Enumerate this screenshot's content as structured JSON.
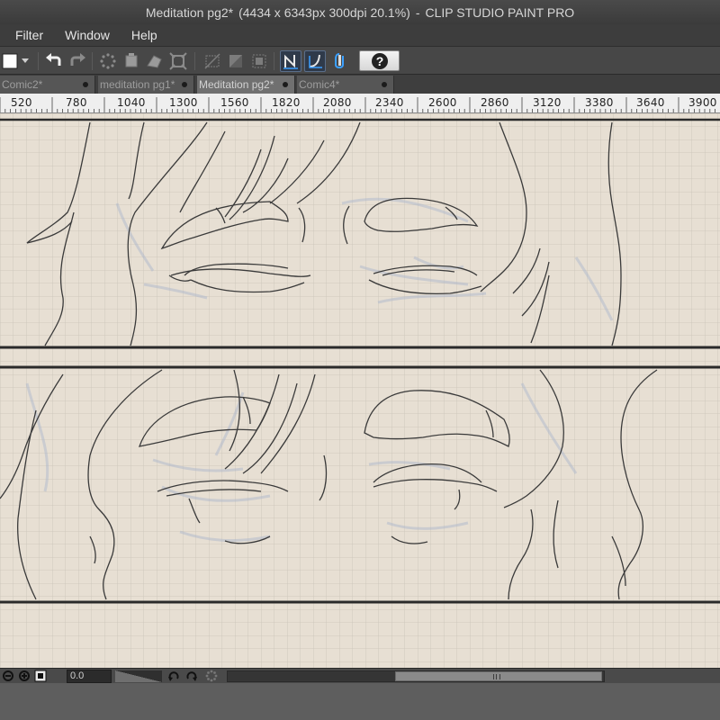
{
  "window": {
    "title_main": "Meditation pg2*",
    "title_info": "(4434 x 6343px 300dpi 20.1%)",
    "title_sep": "-",
    "app_name": "CLIP STUDIO PAINT PRO"
  },
  "menu": {
    "items": [
      "Filter",
      "Window",
      "Help"
    ]
  },
  "toolbar": {
    "icons": [
      "color-swatch-icon",
      "dropdown-arrow-icon",
      "undo-icon",
      "redo-icon",
      "clear-icon",
      "fill-icon",
      "transform-icon",
      "scale-icon",
      "deselect-icon",
      "invert-selection-icon",
      "selection-border-icon",
      "snap-to-ruler-icon",
      "snap-to-special-ruler-icon",
      "snap-to-grid-icon",
      "help-icon"
    ]
  },
  "tabs": [
    {
      "label": "Comic2*",
      "active": false
    },
    {
      "label": "meditation pg1*",
      "active": false
    },
    {
      "label": "Meditation pg2*",
      "active": true
    },
    {
      "label": "Comic4*",
      "active": false
    }
  ],
  "ruler": {
    "labels": [
      "520",
      "780",
      "1040",
      "1300",
      "1560",
      "1820",
      "2080",
      "2340",
      "2600",
      "2860",
      "3120",
      "3380",
      "3640",
      "3900"
    ]
  },
  "navigator": {
    "zoom_value": "0.0",
    "icons": [
      "zoom-out-icon",
      "zoom-in-icon",
      "fit-screen-icon",
      "rotate-left-icon",
      "rotate-right-icon",
      "reset-rotation-icon"
    ]
  },
  "colors": {
    "paper": "#e7dfd3",
    "grid": "#c9c3bb",
    "panel_border": "#2a2a2a",
    "ui_dark": "#3d3d3d",
    "active_toggle": "#5a6e8a"
  }
}
